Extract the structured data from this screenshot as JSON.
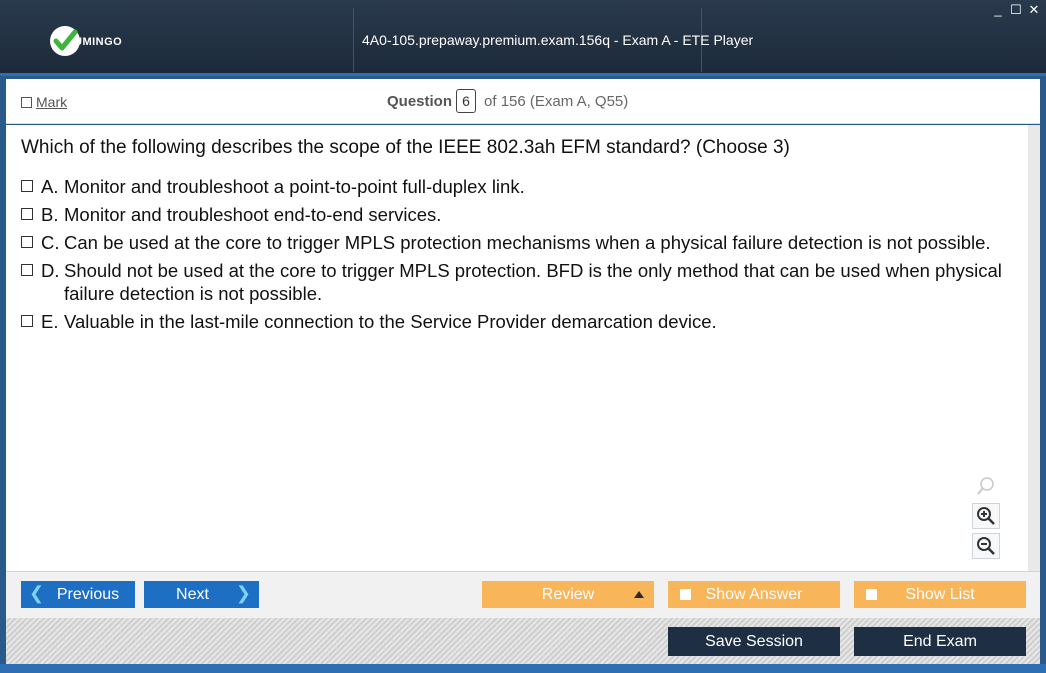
{
  "app": {
    "logo_text": "UMINGO",
    "title": "4A0-105.prepaway.premium.exam.156q - Exam A - ETE Player",
    "window_controls": {
      "minimize": "_",
      "maximize": "☐",
      "close": "✕"
    }
  },
  "header": {
    "mark_label": "Mark",
    "question_label": "Question",
    "question_number": "6",
    "question_of": "of 156 (Exam A, Q55)"
  },
  "question": {
    "text": "Which of the following describes the scope of the IEEE 802.3ah EFM standard? (Choose 3)",
    "options": [
      {
        "letter": "A.",
        "text": "Monitor and troubleshoot a point-to-point full-duplex link."
      },
      {
        "letter": "B.",
        "text": "Monitor and troubleshoot end-to-end services."
      },
      {
        "letter": "C.",
        "text": "Can be used at the core to trigger MPLS protection mechanisms when a physical failure detection is not possible."
      },
      {
        "letter": "D.",
        "text": "Should not be used at the core to trigger MPLS protection. BFD is the only method that can be used when physical failure detection is not possible."
      },
      {
        "letter": "E.",
        "text": "Valuable in the last-mile connection to the Service Provider demarcation device."
      }
    ]
  },
  "zoom": {
    "icons": [
      "zoom-icon",
      "zoom-in-icon",
      "zoom-out-icon"
    ]
  },
  "nav": {
    "previous": "Previous",
    "next": "Next",
    "review": "Review",
    "show_answer": "Show Answer",
    "show_list": "Show List"
  },
  "footer": {
    "save_session": "Save Session",
    "end_exam": "End Exam"
  },
  "colors": {
    "titlebar": "#1c2a3a",
    "accent_blue": "#1d6fc4",
    "orange": "#f9b55a",
    "dark_button": "#1e2f44"
  }
}
